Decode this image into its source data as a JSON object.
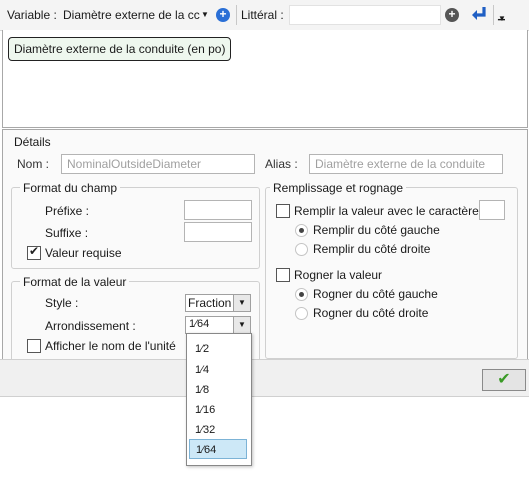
{
  "toolbar": {
    "variable_label": "Variable :",
    "variable_value": "Diamètre externe de la cc",
    "literal_label": "Littéral :",
    "literal_value": ""
  },
  "expression": {
    "token": "Diamètre externe de la conduite (en po)"
  },
  "details": {
    "section_title": "Détails",
    "name_label": "Nom :",
    "name_placeholder": "NominalOutsideDiameter",
    "alias_label": "Alias :",
    "alias_placeholder": "Diamètre externe de la conduite"
  },
  "field_format": {
    "title": "Format du champ",
    "prefix_label": "Préfixe :",
    "prefix_value": "",
    "suffix_label": "Suffixe :",
    "suffix_value": "",
    "required_label": "Valeur requise",
    "required_checked": true
  },
  "value_format": {
    "title": "Format de la valeur",
    "style_label": "Style :",
    "style_value": "Fraction",
    "rounding_label": "Arrondissement :",
    "rounding_value": "1⁄64",
    "show_unit_label": "Afficher le nom de l'unité",
    "show_unit_checked": false
  },
  "fill_trim": {
    "title": "Remplissage et rognage",
    "fill_label": "Remplir la valeur avec le caractère",
    "fill_checked": false,
    "fill_left": "Remplir du côté gauche",
    "fill_right": "Remplir du côté droite",
    "trim_label": "Rogner la valeur",
    "trim_checked": false,
    "trim_left": "Rogner du côté gauche",
    "trim_right": "Rogner du côté droite"
  },
  "rounding_options": [
    "1⁄2",
    "1⁄4",
    "1⁄8",
    "1⁄16",
    "1⁄32",
    "1⁄64"
  ],
  "selected_rounding_index": 5,
  "icons": {
    "add_variable": "plus-circle-icon",
    "add_literal": "plus-circle-icon",
    "insert": "insert-arrow-icon",
    "menu": "chevron-down-icon",
    "ok": "check-icon"
  },
  "colors": {
    "accent_blue": "#2a6fd6",
    "ok_green": "#3a9a26",
    "selection": "#cde8f7"
  }
}
